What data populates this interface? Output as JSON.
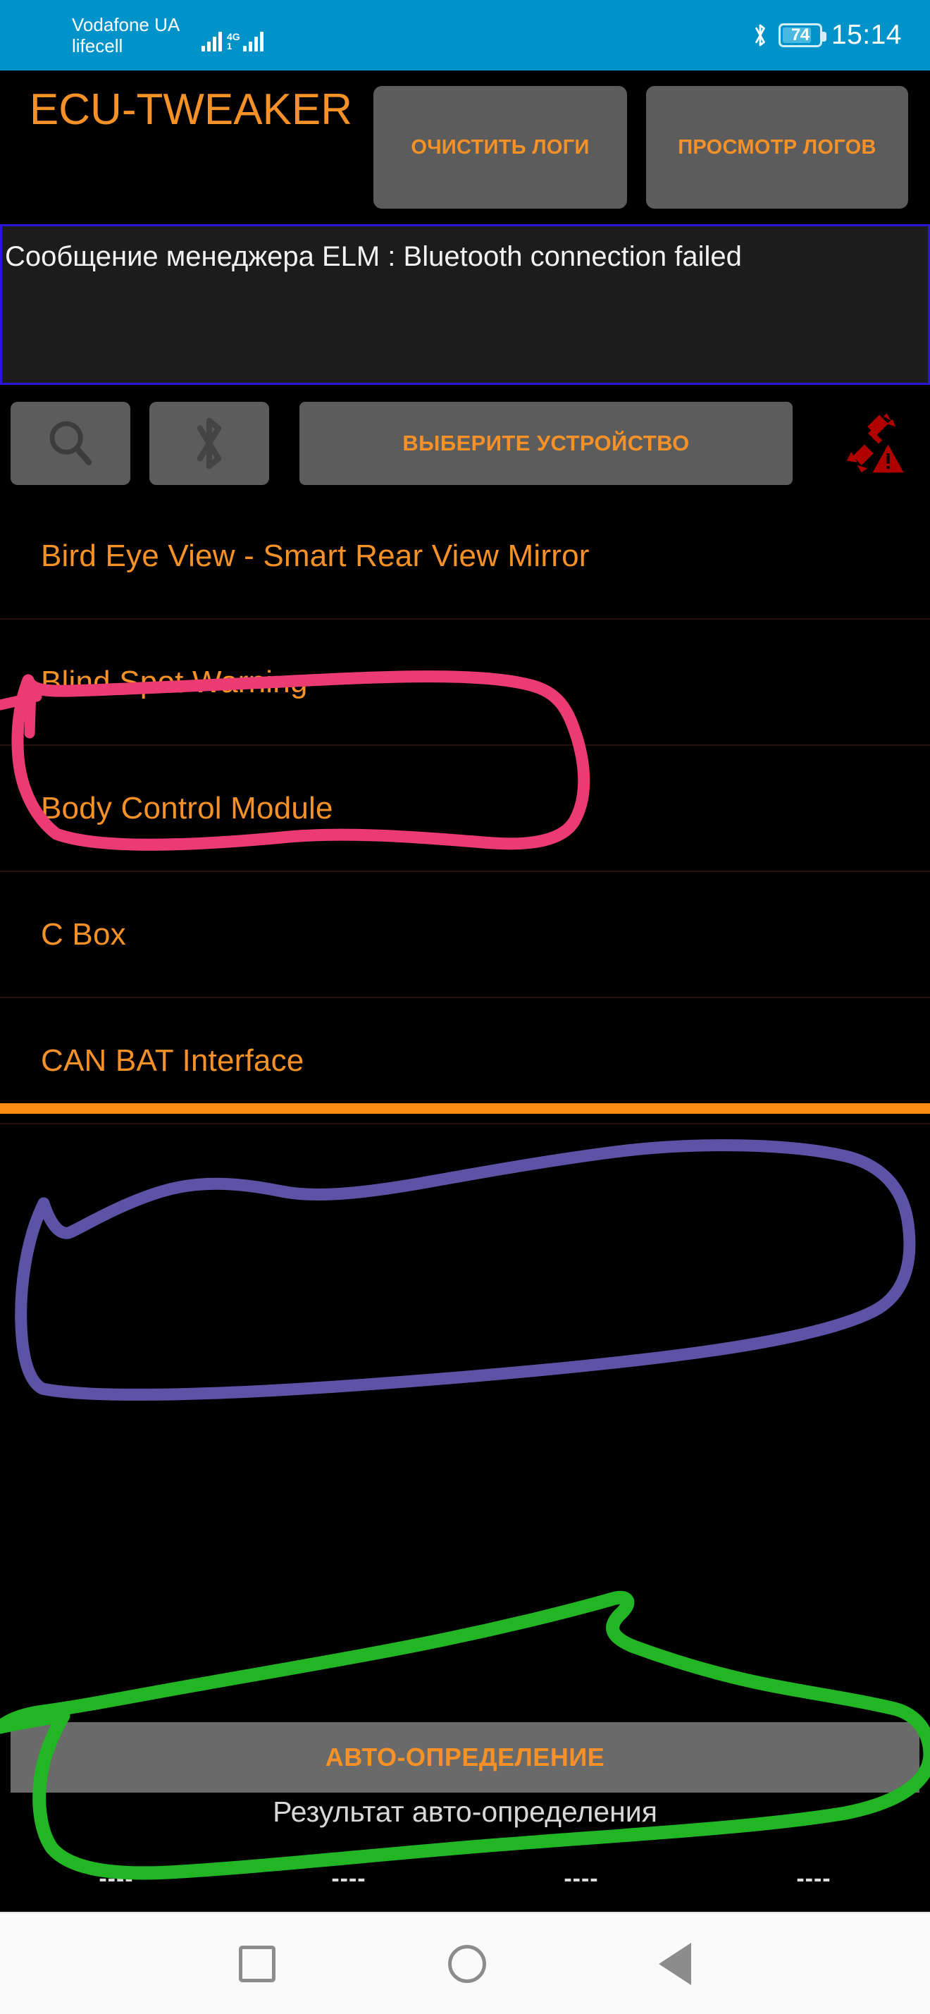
{
  "status_bar": {
    "carrier_line1": "Vodafone UA",
    "carrier_line2": "lifecell",
    "network_type": "4G",
    "bluetooth_icon": "bluetooth-icon",
    "battery_percent": "74",
    "time": "15:14",
    "background_color": "#0093c9"
  },
  "app_header": {
    "title": "ECU-TWEAKER",
    "clear_logs_label": "ОЧИСТИТЬ ЛОГИ",
    "view_logs_label": "ПРОСМОТР ЛОГОВ",
    "accent_color": "#f59127"
  },
  "log_panel": {
    "text": "failed\nСообщение менеджера ELM : Bluetooth connection failed",
    "border_color": "#2a16d8",
    "background_color": "#1c1c1c"
  },
  "toolbar": {
    "search_icon": "search-icon",
    "bluetooth_icon": "bluetooth-icon",
    "select_device_label": "ВЫБЕРИТЕ УСТРОЙСТВО",
    "connection_status_icon": "disconnected-warning-icon",
    "connection_status_color": "#b00000"
  },
  "ecu_list": {
    "items": [
      {
        "label": "Bird Eye View - Smart Rear View Mirror"
      },
      {
        "label": "Blind Spot Warning"
      },
      {
        "label": "Body Control Module"
      },
      {
        "label": "C Box"
      },
      {
        "label": "CAN BAT Interface"
      }
    ]
  },
  "separator": {
    "color": "#fb8c13"
  },
  "auto_detect": {
    "button_label": "АВТО-ОПРЕДЕЛЕНИЕ",
    "result_caption": "Результат авто-определения",
    "result_values": [
      "----",
      "----",
      "----",
      "----"
    ]
  },
  "nav_bar": {
    "recents_icon": "square-recents-icon",
    "home_icon": "circle-home-icon",
    "back_icon": "triangle-back-icon"
  },
  "annotations": [
    {
      "name": "pink-highlight-body-control-module",
      "color": "#ec3b72"
    },
    {
      "name": "purple-highlight-empty-area",
      "color": "#5d53a6"
    },
    {
      "name": "green-highlight-auto-detect",
      "color": "#22b524"
    }
  ]
}
